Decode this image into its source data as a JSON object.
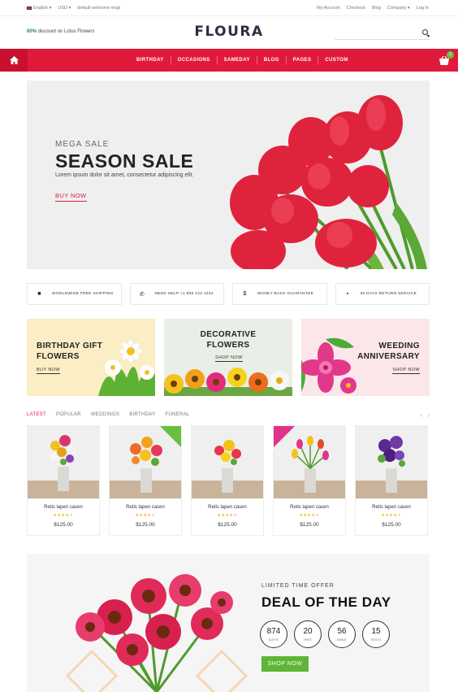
{
  "topbar": {
    "language": "English",
    "currency": "USD",
    "welcome": "default welcome msg!",
    "links": [
      "My Account",
      "Checkout",
      "Blog",
      "Company",
      "Log In"
    ]
  },
  "header": {
    "promo_pct": "60%",
    "promo_text": " discount on Lotus Flowers",
    "logo": "FLOURA",
    "search_placeholder": ""
  },
  "nav": {
    "items": [
      "BIRTHDAY",
      "OCCASIONS",
      "SAMEDAY",
      "BLOG",
      "PAGES",
      "CUSTOM"
    ],
    "cart_count": "2",
    "accent": "#e11a3c"
  },
  "hero": {
    "eyebrow": "MEGA SALE",
    "title": "SEASON SALE",
    "subtitle": "Lorem ipsum dolor sit amet, consectetur adipiscing elit.",
    "cta": "BUY NOW"
  },
  "features": [
    {
      "icon": "truck-icon",
      "label": "WORLDWIDE FREE SHIPPING"
    },
    {
      "icon": "phone-icon",
      "label": "NEED HELP +1 800 123 1234"
    },
    {
      "icon": "dollar-icon",
      "label": "MONEY BACK GUARANTEE"
    },
    {
      "icon": "briefcase-icon",
      "label": "30 DAYS RETURN SERVICE"
    }
  ],
  "banners": [
    {
      "title1": "BIRTHDAY GIFT",
      "title2": "FLOWERS",
      "cta": "BUY NOW"
    },
    {
      "title1": "DECORATIVE",
      "title2": "FLOWERS",
      "cta": "SHOP NOW"
    },
    {
      "title1": "WEEDING",
      "title2": "ANNIVERSARY",
      "cta": "SHOP NOW"
    }
  ],
  "tabs": [
    "LATEST",
    "POPULAR",
    "WEDDINGS",
    "BIRTHDAY",
    "FUNERAL"
  ],
  "products": [
    {
      "name": "Retis lapen casen",
      "price": "$125.00",
      "rating": 4
    },
    {
      "name": "Retis lapen casen",
      "price": "$125.00",
      "rating": 4,
      "badge": "-5%"
    },
    {
      "name": "Retis lapen casen",
      "price": "$125.00",
      "rating": 4
    },
    {
      "name": "Retis lapen casen",
      "price": "$125.00",
      "rating": 4,
      "badge": "HOT"
    },
    {
      "name": "Retis lapen casen",
      "price": "$125.00",
      "rating": 4
    }
  ],
  "deal": {
    "eyebrow": "LIMITED TIME OFFER",
    "title": "DEAL OF THE DAY",
    "countdown": [
      {
        "value": "874",
        "unit": "DAYS"
      },
      {
        "value": "20",
        "unit": "HRS"
      },
      {
        "value": "56",
        "unit": "MINS"
      },
      {
        "value": "15",
        "unit": "SECS"
      }
    ],
    "cta": "SHOP NOW"
  }
}
